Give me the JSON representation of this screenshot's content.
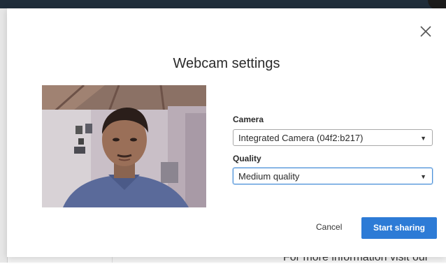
{
  "modal": {
    "title": "Webcam settings",
    "close_icon": "close-icon",
    "camera": {
      "label": "Camera",
      "selected": "Integrated Camera (04f2:b217)"
    },
    "quality": {
      "label": "Quality",
      "selected": "Medium quality"
    },
    "cancel_label": "Cancel",
    "start_label": "Start sharing"
  },
  "background": {
    "footer_text": "For more information visit our"
  },
  "colors": {
    "primary_button": "#2d7bd6",
    "focus_border": "#4a90d9"
  }
}
